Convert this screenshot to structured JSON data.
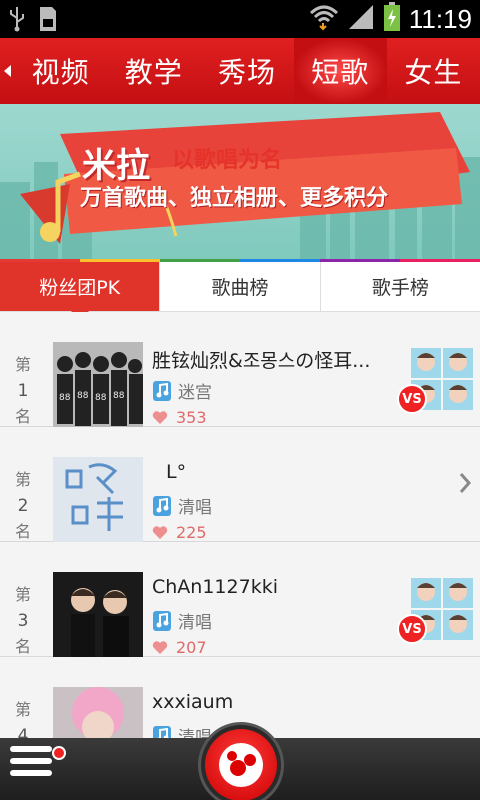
{
  "status_bar": {
    "time": "11:19"
  },
  "categories": [
    {
      "label": "视频",
      "active": false
    },
    {
      "label": "教学",
      "active": false
    },
    {
      "label": "秀场",
      "active": false
    },
    {
      "label": "短歌",
      "active": true
    },
    {
      "label": "女生",
      "active": false
    }
  ],
  "banner": {
    "title": "米拉",
    "slogan": "以歌唱为名",
    "subtitle": "万首歌曲、独立相册、更多积分"
  },
  "sub_tabs": [
    {
      "label": "粉丝团PK",
      "active": true
    },
    {
      "label": "歌曲榜",
      "active": false
    },
    {
      "label": "歌手榜",
      "active": false
    }
  ],
  "rank_prefix": "第",
  "rank_suffix": "名",
  "rows": [
    {
      "rank": "1",
      "name": "胜铉灿烈&조몽스の怪耳...",
      "song": "迷宫",
      "likes": "353",
      "vs": "VS"
    },
    {
      "rank": "2",
      "name": "L°",
      "song": "清唱",
      "likes": "225"
    },
    {
      "rank": "3",
      "name": "ChAn1127kki",
      "song": "清唱",
      "likes": "207",
      "vs": "VS"
    },
    {
      "rank": "4",
      "name": "xxxiaum",
      "song": "清唱十分钟",
      "likes": ""
    }
  ],
  "colors": {
    "brand_red": "#c40f12",
    "accent_red": "#e0342a",
    "likes_pink": "#e06a6a"
  }
}
